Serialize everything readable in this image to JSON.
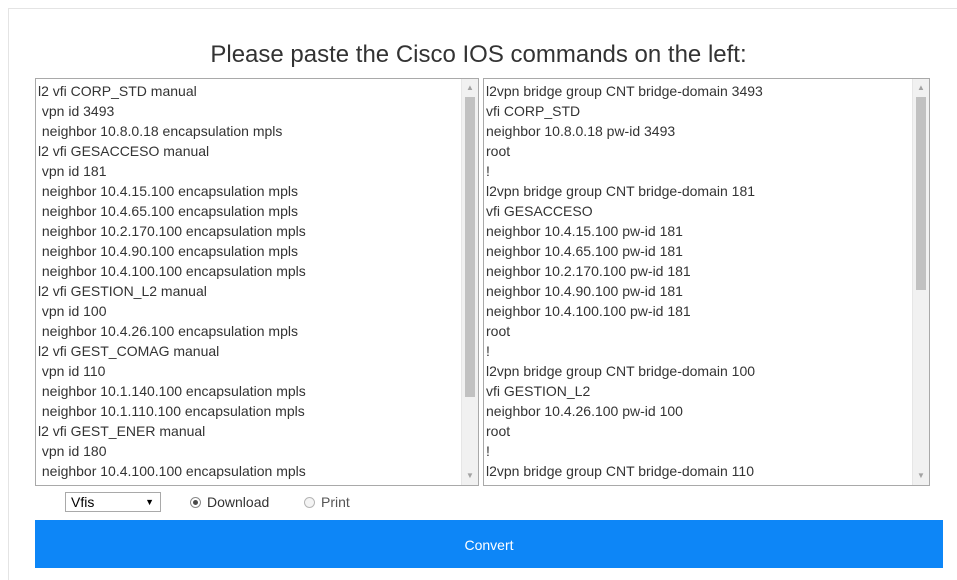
{
  "heading": "Please paste the Cisco IOS commands on the left:",
  "input_lines": [
    "l2 vfi CORP_STD manual",
    " vpn id 3493",
    " neighbor 10.8.0.18 encapsulation mpls",
    "l2 vfi GESACCESO manual",
    " vpn id 181",
    " neighbor 10.4.15.100 encapsulation mpls",
    " neighbor 10.4.65.100 encapsulation mpls",
    " neighbor 10.2.170.100 encapsulation mpls",
    " neighbor 10.4.90.100 encapsulation mpls",
    " neighbor 10.4.100.100 encapsulation mpls",
    "l2 vfi GESTION_L2 manual",
    " vpn id 100",
    " neighbor 10.4.26.100 encapsulation mpls",
    "l2 vfi GEST_COMAG manual",
    " vpn id 110",
    " neighbor 10.1.140.100 encapsulation mpls",
    " neighbor 10.1.110.100 encapsulation mpls",
    "l2 vfi GEST_ENER manual",
    " vpn id 180",
    " neighbor 10.4.100.100 encapsulation mpls"
  ],
  "output_lines": [
    "l2vpn bridge group CNT bridge-domain 3493",
    "vfi CORP_STD",
    "neighbor 10.8.0.18 pw-id 3493",
    "root",
    "!",
    "l2vpn bridge group CNT bridge-domain 181",
    "vfi GESACCESO",
    "neighbor 10.4.15.100 pw-id 181",
    "neighbor 10.4.65.100 pw-id 181",
    "neighbor 10.2.170.100 pw-id 181",
    "neighbor 10.4.90.100 pw-id 181",
    "neighbor 10.4.100.100 pw-id 181",
    "root",
    "!",
    "l2vpn bridge group CNT bridge-domain 100",
    "vfi GESTION_L2",
    "neighbor 10.4.26.100 pw-id 100",
    "root",
    "!",
    "l2vpn bridge group CNT bridge-domain 110"
  ],
  "controls": {
    "select_value": "Vfis",
    "select_caret_icon": "triangle-down-icon",
    "radio_download": "Download",
    "radio_print": "Print",
    "selected_radio": "Download"
  },
  "convert_label": "Convert",
  "colors": {
    "accent": "#0d86f7",
    "text": "#333333"
  }
}
